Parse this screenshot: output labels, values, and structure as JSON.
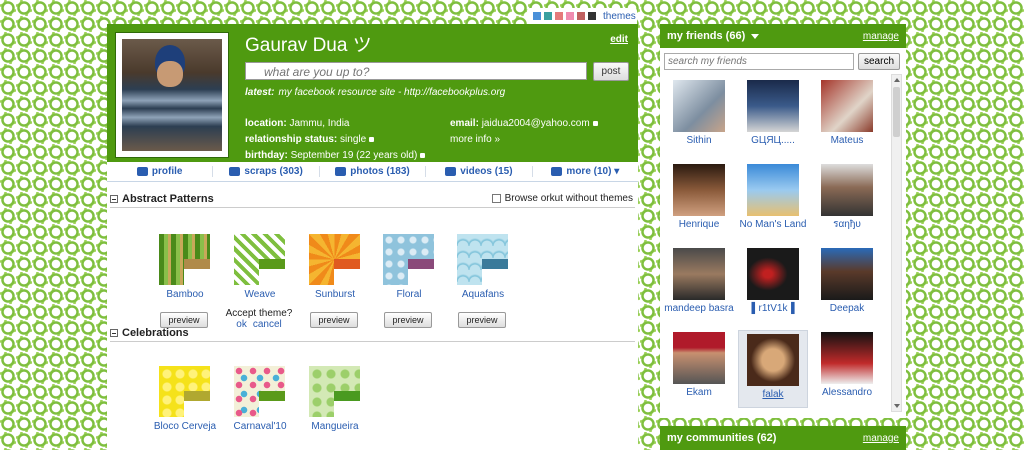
{
  "themes_strip": {
    "label": "themes",
    "swatches": [
      "#4a90d9",
      "#3aa0a0",
      "#e57a7a",
      "#f08cb0",
      "#c06060",
      "#333333"
    ]
  },
  "profile": {
    "name": "Gaurav Dua ツ",
    "edit_label": "edit",
    "status_placeholder": "what are you up to?",
    "post_label": "post",
    "latest_label": "latest:",
    "latest_text": "my facebook resource site - http://facebookplus.org",
    "location_label": "location:",
    "location_value": "Jammu, India",
    "relationship_label": "relationship status:",
    "relationship_value": "single",
    "birthday_label": "birthday:",
    "birthday_value": "September 19 (22 years old)",
    "email_label": "email:",
    "email_value": "jaidua2004@yahoo.com",
    "more_info": "more info »"
  },
  "tabs": [
    {
      "label": "profile",
      "icon": "shield-icon"
    },
    {
      "label": "scraps (303)",
      "icon": "scrap-icon"
    },
    {
      "label": "photos (183)",
      "icon": "camera-icon"
    },
    {
      "label": "videos (15)",
      "icon": "video-icon"
    },
    {
      "label": "more (10) ▾",
      "icon": "plus-icon"
    }
  ],
  "abstract_section": {
    "title": "Abstract Patterns",
    "browse_label": "Browse orkut without themes",
    "themes": [
      {
        "name": "Bamboo",
        "accent": "#b08a4a"
      },
      {
        "name": "Weave",
        "accent": "#5a9a1a"
      },
      {
        "name": "Sunburst",
        "accent": "#e05a20"
      },
      {
        "name": "Floral",
        "accent": "#8a4a7a"
      },
      {
        "name": "Aquafans",
        "accent": "#3a7a9a"
      }
    ],
    "preview_label": "preview",
    "accept_text": "Accept theme?",
    "ok_label": "ok",
    "cancel_label": "cancel"
  },
  "celebrations_section": {
    "title": "Celebrations",
    "themes": [
      {
        "name": "Bloco Cerveja",
        "accent": "#b0a830"
      },
      {
        "name": "Carnaval'10",
        "accent": "#5a9a1a"
      },
      {
        "name": "Mangueira",
        "accent": "#4a9a20"
      }
    ]
  },
  "friends": {
    "title": "my friends (66)",
    "manage_label": "manage",
    "search_placeholder": "search my friends",
    "search_label": "search",
    "list": [
      {
        "name": "Sithin"
      },
      {
        "name": "GЦЯЦ....."
      },
      {
        "name": "Mateus"
      },
      {
        "name": "Henrique"
      },
      {
        "name": "No Man's Land"
      },
      {
        "name": "รαηђυ"
      },
      {
        "name": "mandeep basra"
      },
      {
        "name": "▌r1tV1k▐"
      },
      {
        "name": "Deepak"
      },
      {
        "name": "Ekam"
      },
      {
        "name": "falak"
      },
      {
        "name": "Alessandro"
      }
    ]
  },
  "communities": {
    "title": "my communities (62)",
    "manage_label": "manage"
  }
}
